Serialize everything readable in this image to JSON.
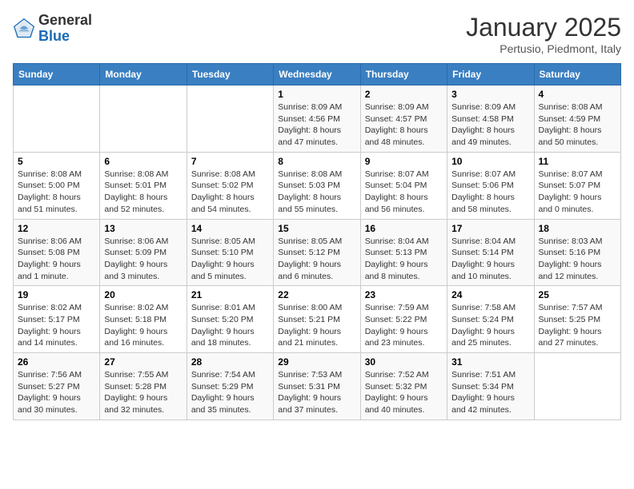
{
  "header": {
    "logo_general": "General",
    "logo_blue": "Blue",
    "month": "January 2025",
    "location": "Pertusio, Piedmont, Italy"
  },
  "weekdays": [
    "Sunday",
    "Monday",
    "Tuesday",
    "Wednesday",
    "Thursday",
    "Friday",
    "Saturday"
  ],
  "weeks": [
    [
      {
        "day": "",
        "info": ""
      },
      {
        "day": "",
        "info": ""
      },
      {
        "day": "",
        "info": ""
      },
      {
        "day": "1",
        "info": "Sunrise: 8:09 AM\nSunset: 4:56 PM\nDaylight: 8 hours\nand 47 minutes."
      },
      {
        "day": "2",
        "info": "Sunrise: 8:09 AM\nSunset: 4:57 PM\nDaylight: 8 hours\nand 48 minutes."
      },
      {
        "day": "3",
        "info": "Sunrise: 8:09 AM\nSunset: 4:58 PM\nDaylight: 8 hours\nand 49 minutes."
      },
      {
        "day": "4",
        "info": "Sunrise: 8:08 AM\nSunset: 4:59 PM\nDaylight: 8 hours\nand 50 minutes."
      }
    ],
    [
      {
        "day": "5",
        "info": "Sunrise: 8:08 AM\nSunset: 5:00 PM\nDaylight: 8 hours\nand 51 minutes."
      },
      {
        "day": "6",
        "info": "Sunrise: 8:08 AM\nSunset: 5:01 PM\nDaylight: 8 hours\nand 52 minutes."
      },
      {
        "day": "7",
        "info": "Sunrise: 8:08 AM\nSunset: 5:02 PM\nDaylight: 8 hours\nand 54 minutes."
      },
      {
        "day": "8",
        "info": "Sunrise: 8:08 AM\nSunset: 5:03 PM\nDaylight: 8 hours\nand 55 minutes."
      },
      {
        "day": "9",
        "info": "Sunrise: 8:07 AM\nSunset: 5:04 PM\nDaylight: 8 hours\nand 56 minutes."
      },
      {
        "day": "10",
        "info": "Sunrise: 8:07 AM\nSunset: 5:06 PM\nDaylight: 8 hours\nand 58 minutes."
      },
      {
        "day": "11",
        "info": "Sunrise: 8:07 AM\nSunset: 5:07 PM\nDaylight: 9 hours\nand 0 minutes."
      }
    ],
    [
      {
        "day": "12",
        "info": "Sunrise: 8:06 AM\nSunset: 5:08 PM\nDaylight: 9 hours\nand 1 minute."
      },
      {
        "day": "13",
        "info": "Sunrise: 8:06 AM\nSunset: 5:09 PM\nDaylight: 9 hours\nand 3 minutes."
      },
      {
        "day": "14",
        "info": "Sunrise: 8:05 AM\nSunset: 5:10 PM\nDaylight: 9 hours\nand 5 minutes."
      },
      {
        "day": "15",
        "info": "Sunrise: 8:05 AM\nSunset: 5:12 PM\nDaylight: 9 hours\nand 6 minutes."
      },
      {
        "day": "16",
        "info": "Sunrise: 8:04 AM\nSunset: 5:13 PM\nDaylight: 9 hours\nand 8 minutes."
      },
      {
        "day": "17",
        "info": "Sunrise: 8:04 AM\nSunset: 5:14 PM\nDaylight: 9 hours\nand 10 minutes."
      },
      {
        "day": "18",
        "info": "Sunrise: 8:03 AM\nSunset: 5:16 PM\nDaylight: 9 hours\nand 12 minutes."
      }
    ],
    [
      {
        "day": "19",
        "info": "Sunrise: 8:02 AM\nSunset: 5:17 PM\nDaylight: 9 hours\nand 14 minutes."
      },
      {
        "day": "20",
        "info": "Sunrise: 8:02 AM\nSunset: 5:18 PM\nDaylight: 9 hours\nand 16 minutes."
      },
      {
        "day": "21",
        "info": "Sunrise: 8:01 AM\nSunset: 5:20 PM\nDaylight: 9 hours\nand 18 minutes."
      },
      {
        "day": "22",
        "info": "Sunrise: 8:00 AM\nSunset: 5:21 PM\nDaylight: 9 hours\nand 21 minutes."
      },
      {
        "day": "23",
        "info": "Sunrise: 7:59 AM\nSunset: 5:22 PM\nDaylight: 9 hours\nand 23 minutes."
      },
      {
        "day": "24",
        "info": "Sunrise: 7:58 AM\nSunset: 5:24 PM\nDaylight: 9 hours\nand 25 minutes."
      },
      {
        "day": "25",
        "info": "Sunrise: 7:57 AM\nSunset: 5:25 PM\nDaylight: 9 hours\nand 27 minutes."
      }
    ],
    [
      {
        "day": "26",
        "info": "Sunrise: 7:56 AM\nSunset: 5:27 PM\nDaylight: 9 hours\nand 30 minutes."
      },
      {
        "day": "27",
        "info": "Sunrise: 7:55 AM\nSunset: 5:28 PM\nDaylight: 9 hours\nand 32 minutes."
      },
      {
        "day": "28",
        "info": "Sunrise: 7:54 AM\nSunset: 5:29 PM\nDaylight: 9 hours\nand 35 minutes."
      },
      {
        "day": "29",
        "info": "Sunrise: 7:53 AM\nSunset: 5:31 PM\nDaylight: 9 hours\nand 37 minutes."
      },
      {
        "day": "30",
        "info": "Sunrise: 7:52 AM\nSunset: 5:32 PM\nDaylight: 9 hours\nand 40 minutes."
      },
      {
        "day": "31",
        "info": "Sunrise: 7:51 AM\nSunset: 5:34 PM\nDaylight: 9 hours\nand 42 minutes."
      },
      {
        "day": "",
        "info": ""
      }
    ]
  ]
}
